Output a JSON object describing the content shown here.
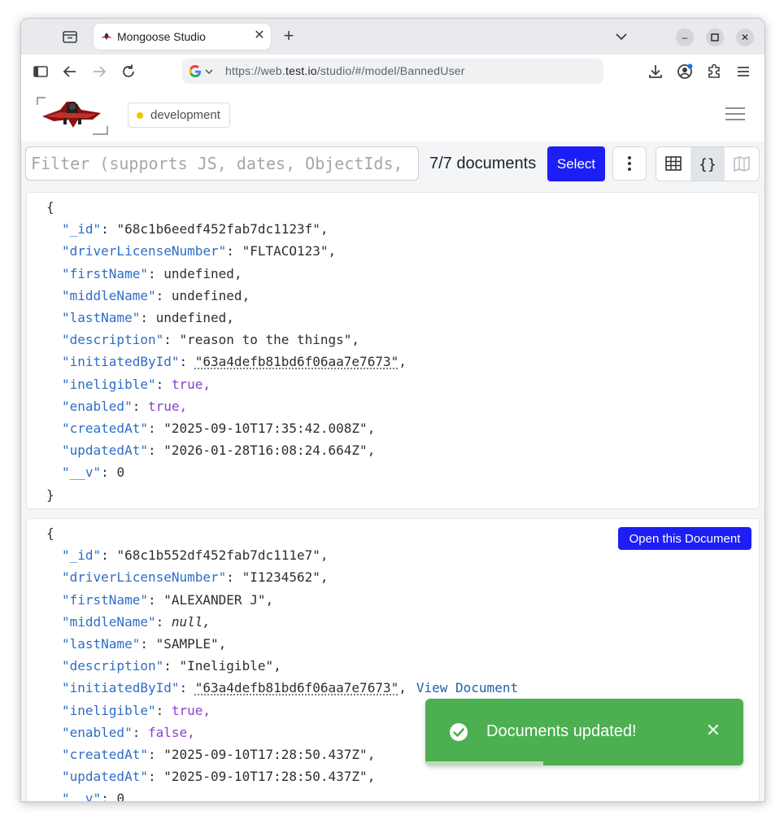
{
  "browser": {
    "tab_title": "Mongoose Studio",
    "url_prefix": "https://web.",
    "url_host": "test.io",
    "url_path": "/studio/#/model/BannedUser"
  },
  "header": {
    "env_label": "development"
  },
  "filter": {
    "placeholder": "Filter (supports JS, dates, ObjectIds, and more)",
    "doc_count": "7/7 documents",
    "select_label": "Select"
  },
  "documents": [
    {
      "open_label": "",
      "fields": [
        {
          "key": "\"_id\"",
          "value": "\"68c1b6eedf452fab7dc1123f\"",
          "type": "str",
          "comma": ","
        },
        {
          "key": "\"driverLicenseNumber\"",
          "value": "\"FLTACO123\"",
          "type": "str",
          "comma": ","
        },
        {
          "key": "\"firstName\"",
          "value": "undefined",
          "type": "undef",
          "comma": ","
        },
        {
          "key": "\"middleName\"",
          "value": "undefined",
          "type": "undef",
          "comma": ","
        },
        {
          "key": "\"lastName\"",
          "value": "undefined",
          "type": "undef",
          "comma": ","
        },
        {
          "key": "\"description\"",
          "value": "\"reason to the things\"",
          "type": "str",
          "comma": ","
        },
        {
          "key": "\"initiatedById\"",
          "value": "\"63a4defb81bd6f06aa7e7673\"",
          "type": "oid",
          "comma": ","
        },
        {
          "key": "\"ineligible\"",
          "value": "true,",
          "type": "bool",
          "comma": ""
        },
        {
          "key": "\"enabled\"",
          "value": "true,",
          "type": "bool",
          "comma": ""
        },
        {
          "key": "\"createdAt\"",
          "value": "\"2025-09-10T17:35:42.008Z\"",
          "type": "str",
          "comma": ","
        },
        {
          "key": "\"updatedAt\"",
          "value": "\"2026-01-28T16:08:24.664Z\"",
          "type": "str",
          "comma": ","
        },
        {
          "key": "\"__v\"",
          "value": "0",
          "type": "str",
          "comma": ""
        }
      ]
    },
    {
      "open_label": "Open this Document",
      "view_document_label": "View Document",
      "fields": [
        {
          "key": "\"_id\"",
          "value": "\"68c1b552df452fab7dc111e7\"",
          "type": "str",
          "comma": ","
        },
        {
          "key": "\"driverLicenseNumber\"",
          "value": "\"I1234562\"",
          "type": "str",
          "comma": ","
        },
        {
          "key": "\"firstName\"",
          "value": "\"ALEXANDER J\"",
          "type": "str",
          "comma": ","
        },
        {
          "key": "\"middleName\"",
          "value": "null,",
          "type": "nul",
          "comma": ""
        },
        {
          "key": "\"lastName\"",
          "value": "\"SAMPLE\"",
          "type": "str",
          "comma": ","
        },
        {
          "key": "\"description\"",
          "value": "\"Ineligible\"",
          "type": "str",
          "comma": ","
        },
        {
          "key": "\"initiatedById\"",
          "value": "\"63a4defb81bd6f06aa7e7673\"",
          "type": "oid",
          "comma": ","
        },
        {
          "key": "\"ineligible\"",
          "value": "true,",
          "type": "bool",
          "comma": ""
        },
        {
          "key": "\"enabled\"",
          "value": "false,",
          "type": "bool",
          "comma": ""
        },
        {
          "key": "\"createdAt\"",
          "value": "\"2025-09-10T17:28:50.437Z\"",
          "type": "str",
          "comma": ","
        },
        {
          "key": "\"updatedAt\"",
          "value": "\"2025-09-10T17:28:50.437Z\"",
          "type": "str",
          "comma": ","
        },
        {
          "key": "\"__v\"",
          "value": "0",
          "type": "str",
          "comma": ""
        }
      ]
    }
  ],
  "json_syntax": {
    "open_brace": "{",
    "close_brace": "}",
    "colon": ": "
  },
  "toast": {
    "message": "Documents updated!",
    "progress_fraction": 0.37
  },
  "colors": {
    "primary": "#1d1df5",
    "toast_green": "#4caf50",
    "json_key": "#2f6dc5",
    "json_bool": "#8b3fd0",
    "env_dot": "#f3c400"
  },
  "icons": {
    "tab_group": "tab-group-icon",
    "favicon": "mongoose-favicon",
    "close": "close-icon",
    "new_tab": "plus-icon",
    "tab_list": "chevron-down-icon",
    "sidebar": "sidebar-icon",
    "back": "back-arrow-icon",
    "forward": "forward-arrow-icon",
    "reload": "reload-icon",
    "download": "download-icon",
    "profile": "profile-icon",
    "extensions": "puzzle-icon",
    "menu": "menu-icon",
    "table_view": "table-icon",
    "json_view": "braces-icon",
    "map_view": "map-icon",
    "toast_check": "check-circle-icon"
  }
}
